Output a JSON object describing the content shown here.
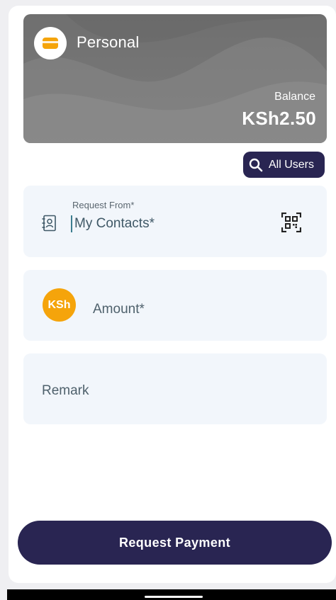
{
  "wallet": {
    "name": "Personal",
    "balance_label": "Balance",
    "balance_value": "KSh2.50",
    "icon": "wallet-icon"
  },
  "all_users_button": {
    "label": "All Users",
    "icon": "search-icon"
  },
  "request_from": {
    "label": "Request From*",
    "value": "My Contacts*",
    "left_icon": "contact-book-icon",
    "right_icon": "qr-code-icon"
  },
  "amount": {
    "currency_badge": "KSh",
    "placeholder": "Amount*"
  },
  "remark": {
    "placeholder": "Remark"
  },
  "submit_button": {
    "label": "Request Payment"
  },
  "colors": {
    "primary": "#292552",
    "accent": "#f5a40b",
    "card": "#777777",
    "field_bg": "#f2f6fb"
  }
}
